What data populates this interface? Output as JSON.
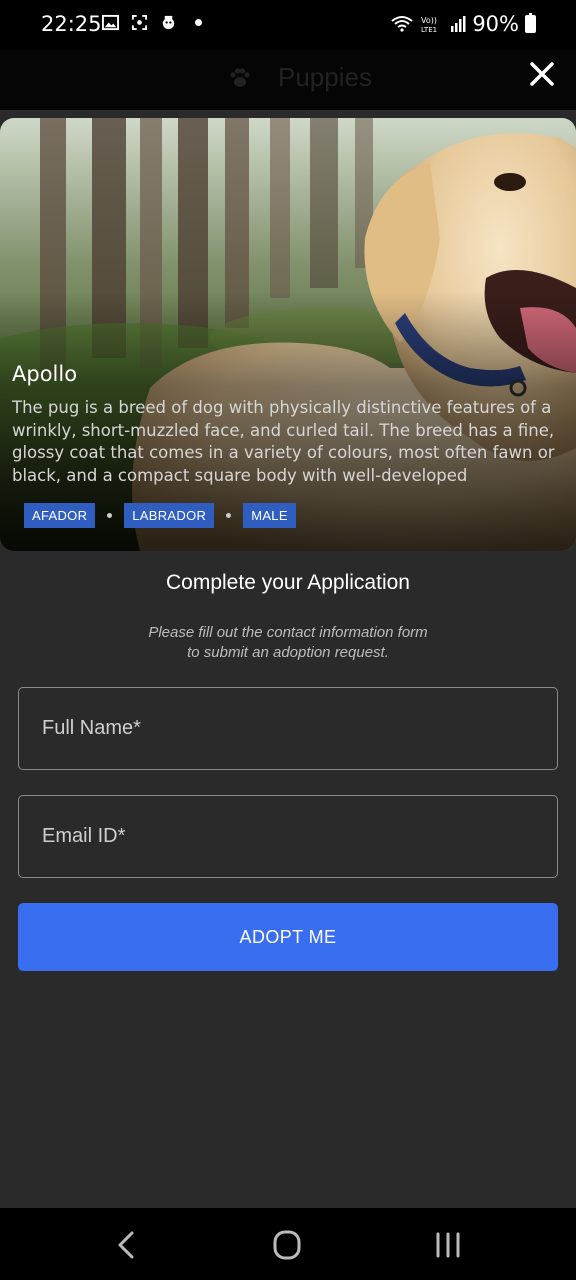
{
  "status_bar": {
    "time": "22:25",
    "battery": "90%",
    "left_icons": [
      "gallery-icon",
      "screenshot-icon",
      "face-icon",
      "dot-icon"
    ],
    "right_icons": [
      "wifi-icon",
      "volte-lte-icon",
      "signal-icon",
      "battery-icon"
    ]
  },
  "header": {
    "title": "Puppies",
    "icon": "paw-icon",
    "close_icon": "close-icon"
  },
  "pet": {
    "name": "Apollo",
    "description": "The pug is a breed of dog with physically distinctive features of a wrinkly, short-muzzled face, and curled tail. The breed has a fine, glossy coat that comes in a variety of colours, most often fawn or black, and a compact square body with well-developed",
    "tags": [
      "AFADOR",
      "LABRADOR",
      "MALE"
    ],
    "tag_color": "#2f5ec0"
  },
  "form": {
    "title": "Complete your Application",
    "subtitle_line1": "Please fill out the contact information form",
    "subtitle_line2": "to submit an adoption request.",
    "name_placeholder": "Full Name*",
    "email_placeholder": "Email ID*",
    "submit_label": "ADOPT ME",
    "accent": "#3a6ef0"
  },
  "nav_bar": {
    "buttons": [
      "back-icon",
      "home-icon",
      "recents-icon"
    ]
  }
}
